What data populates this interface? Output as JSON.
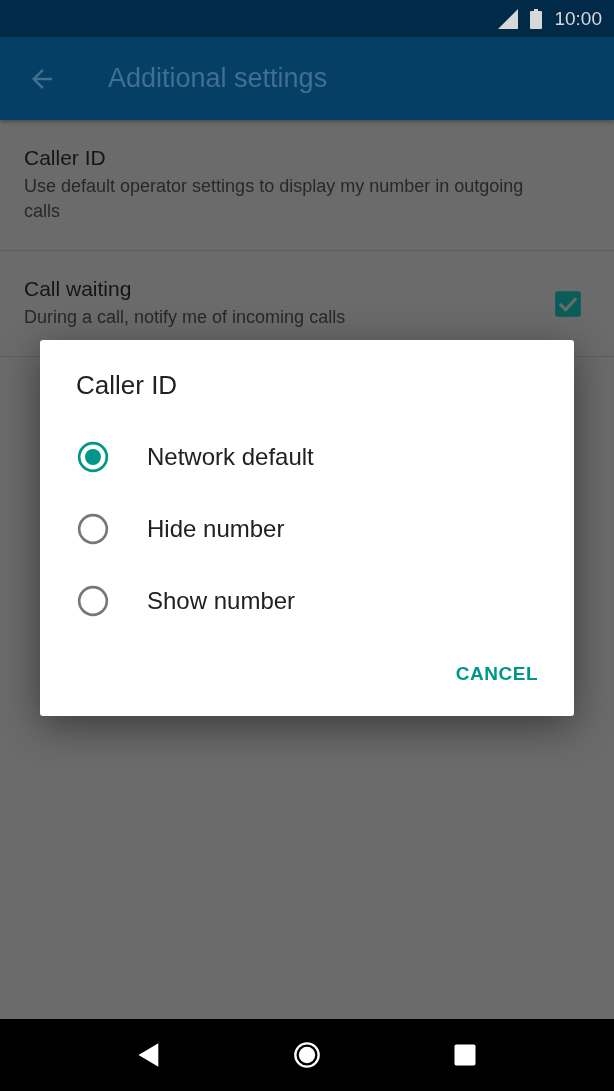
{
  "status_bar": {
    "time": "10:00"
  },
  "app_bar": {
    "title": "Additional settings"
  },
  "settings": [
    {
      "kind": "text",
      "title": "Caller ID",
      "summary": "Use default operator settings to display my number in outgoing calls"
    },
    {
      "kind": "checkbox",
      "title": "Call waiting",
      "summary": "During a call, notify me of incoming calls",
      "checked": true
    }
  ],
  "dialog": {
    "title": "Caller ID",
    "options": [
      {
        "label": "Network default",
        "selected": true
      },
      {
        "label": "Hide number",
        "selected": false
      },
      {
        "label": "Show number",
        "selected": false
      }
    ],
    "buttons": [
      "CANCEL"
    ]
  }
}
